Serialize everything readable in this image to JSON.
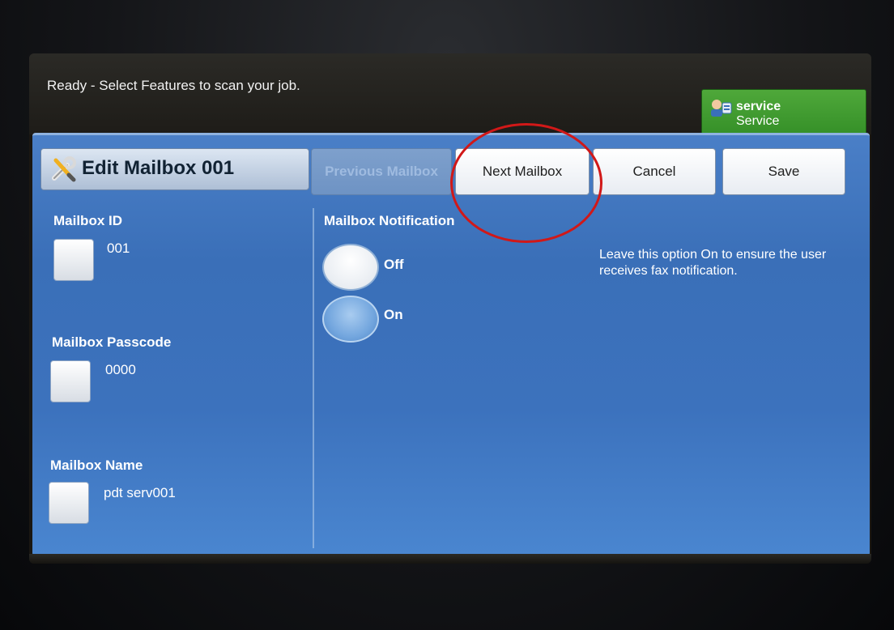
{
  "status": {
    "ghost_text": "Ready - Select Features to scan your job.",
    "text": "Ready -  Select Features to scan your job."
  },
  "service": {
    "line1": "service",
    "line2": "Service",
    "icon": "user-service-icon",
    "color": "#3f9b30"
  },
  "header": {
    "title": "Edit Mailbox 001",
    "icon": "tools-icon"
  },
  "toolbar": {
    "previous_label": "Previous Mailbox",
    "next_label": "Next Mailbox",
    "cancel_label": "Cancel",
    "save_label": "Save"
  },
  "fields": {
    "mailbox_id_label": "Mailbox ID",
    "mailbox_id_value": "001",
    "passcode_label": "Mailbox Passcode",
    "passcode_value": "0000",
    "name_label": "Mailbox Name",
    "name_value": "pdt serv001"
  },
  "notification": {
    "label": "Mailbox Notification",
    "options": [
      {
        "label": "Off",
        "selected": false
      },
      {
        "label": "On",
        "selected": true
      }
    ],
    "hint": "Leave this option On to ensure the user receives fax notification."
  },
  "colors": {
    "panel_blue": "#3c72bd",
    "annotation_red": "#d11818"
  }
}
